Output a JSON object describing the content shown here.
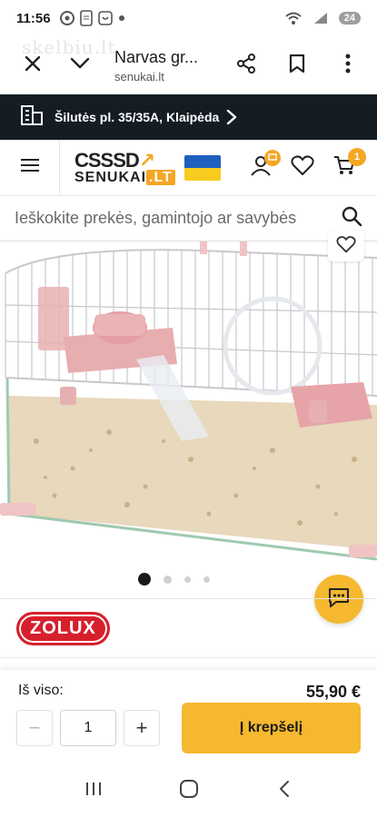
{
  "status_bar": {
    "time": "11:56",
    "battery": "24"
  },
  "watermark": "skelbiu.lt",
  "tab_header": {
    "title": "Narvas gr...",
    "url": "senukai.lt"
  },
  "store_bar": {
    "address": "Šilutės pl. 35/35A, Klaipėda"
  },
  "site_header": {
    "logo_top": "CSSSD",
    "logo_bottom_a": "SENUKAI",
    "logo_bottom_b": ".LT",
    "cart_count": "1",
    "colors": {
      "accent": "#f5a623",
      "flag_blue": "#1f5fbf",
      "flag_yellow": "#f7cc1e"
    }
  },
  "search": {
    "placeholder": "Ieškokite prekės, gamintojo ar savybės"
  },
  "gallery": {
    "dot_count": 4,
    "active_index": 0
  },
  "brand": {
    "name": "ZOLUX"
  },
  "buy_bar": {
    "total_label": "Iš viso:",
    "total_value": "55,90 €",
    "quantity": "1",
    "minus_label": "−",
    "plus_label": "+",
    "add_to_cart": "Į krepšelį"
  },
  "icons": [
    "close-icon",
    "chevron-down-icon",
    "share-icon",
    "bookmark-icon",
    "more-icon",
    "store-icon",
    "chevron-right-icon",
    "menu-icon",
    "user-icon",
    "heart-icon",
    "cart-icon",
    "search-icon",
    "chat-icon"
  ]
}
